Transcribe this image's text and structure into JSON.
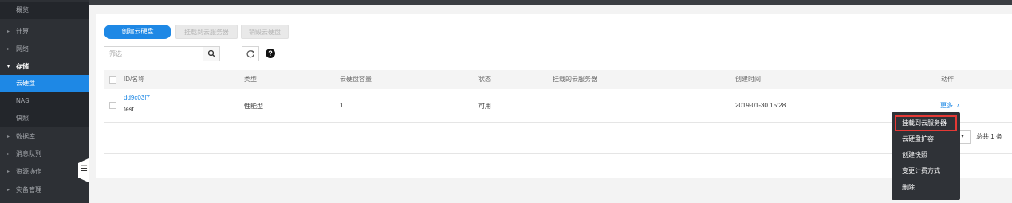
{
  "sidebar": {
    "items": [
      {
        "label": "概览",
        "level": "sub"
      },
      {
        "label": "计算",
        "level": "parent",
        "arrow": "▸"
      },
      {
        "label": "网络",
        "level": "parent",
        "arrow": "▸"
      },
      {
        "label": "存储",
        "level": "parent-open",
        "arrow": "▾"
      },
      {
        "label": "云硬盘",
        "level": "active"
      },
      {
        "label": "NAS",
        "level": "sub"
      },
      {
        "label": "快照",
        "level": "sub"
      },
      {
        "label": "数据库",
        "level": "parent",
        "arrow": "▸"
      },
      {
        "label": "消息队列",
        "level": "parent",
        "arrow": "▸"
      },
      {
        "label": "资源协作",
        "level": "parent",
        "arrow": "▸"
      },
      {
        "label": "灾备管理",
        "level": "parent",
        "arrow": "▸"
      }
    ],
    "toggle_icon": "☰"
  },
  "toolbar": {
    "create_label": "创建云硬盘",
    "attach_label": "挂载到云服务器",
    "destroy_label": "销毁云硬盘",
    "search_placeholder": "筛选",
    "search_icon": "🔍",
    "refresh_icon": "⟳",
    "help_icon": "?"
  },
  "table": {
    "headers": {
      "id_name": "ID/名称",
      "type": "类型",
      "capacity": "云硬盘容量",
      "status": "状态",
      "attached": "挂载的云服务器",
      "created": "创建时间",
      "action": "动作"
    },
    "rows": [
      {
        "id": "dd9c03f7",
        "name": "test",
        "type": "性能型",
        "capacity": "1",
        "status": "可用",
        "attached": "",
        "created": "2019-01-30 15:28",
        "action": "更多",
        "action_icon": "∧"
      }
    ]
  },
  "pagination": {
    "select_icon": "▾",
    "total": "总共 1 条"
  },
  "action_menu": {
    "items": [
      "挂载到云服务器",
      "云硬盘扩容",
      "创建快照",
      "变更计费方式",
      "删除"
    ],
    "highlighted_index": 0,
    "highlight_color": "#e53935"
  },
  "colors": {
    "accent": "#1e88e5",
    "sidebar_bg": "#2d3035",
    "menu_bg": "#2f3237"
  }
}
